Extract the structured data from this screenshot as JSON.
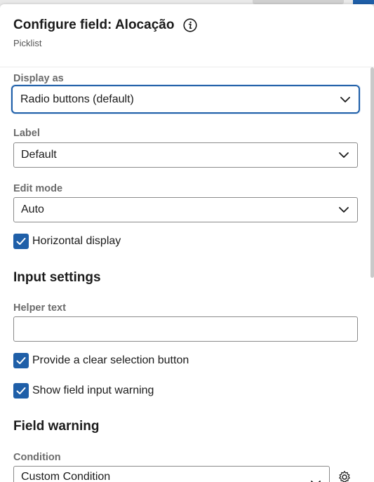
{
  "header": {
    "title": "Configure field: Alocação",
    "subtitle": "Picklist"
  },
  "display_as": {
    "label": "Display as",
    "value": "Radio buttons (default)"
  },
  "label_field": {
    "label": "Label",
    "value": "Default"
  },
  "edit_mode": {
    "label": "Edit mode",
    "value": "Auto"
  },
  "horizontal_display": {
    "label": "Horizontal display",
    "checked": true
  },
  "input_settings": {
    "title": "Input settings",
    "helper_text_label": "Helper text",
    "helper_text_value": "",
    "clear_selection": {
      "label": "Provide a clear selection button",
      "checked": true
    },
    "field_input_warning": {
      "label": "Show field input warning",
      "checked": true
    }
  },
  "field_warning": {
    "title": "Field warning",
    "condition_label": "Condition",
    "condition_value": "Custom Condition"
  },
  "colors": {
    "accent": "#1f5fa8"
  },
  "icons": [
    "info-icon",
    "chevron-down-icon",
    "check-icon",
    "gear-icon"
  ]
}
